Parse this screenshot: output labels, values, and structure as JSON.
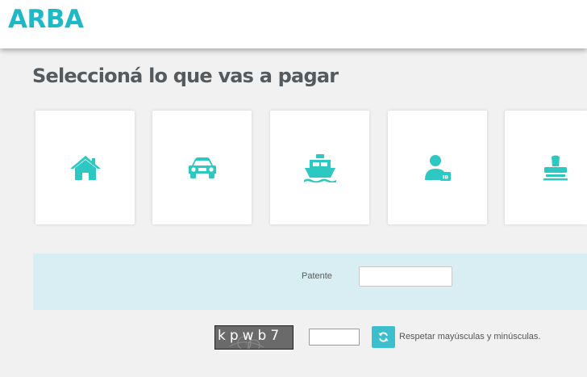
{
  "header": {
    "logo_text": "ARBA"
  },
  "main": {
    "title": "Seleccioná lo que vas a pagar",
    "tax_options": [
      {
        "icon": "house-icon"
      },
      {
        "icon": "car-icon"
      },
      {
        "icon": "boat-icon"
      },
      {
        "icon": "person-badge-icon"
      },
      {
        "icon": "stamp-icon"
      }
    ]
  },
  "form": {
    "patente_label": "Patente",
    "patente_value": ""
  },
  "captcha": {
    "text": "kpwb7",
    "input_value": "",
    "refresh_icon": "refresh-icon",
    "hint": "Respetar mayúsculas y minúsculas."
  },
  "colors": {
    "brand": "#1fb9c6",
    "icon": "#2ec8c3",
    "band": "#d8eef2",
    "button": "#3cbfcc"
  }
}
